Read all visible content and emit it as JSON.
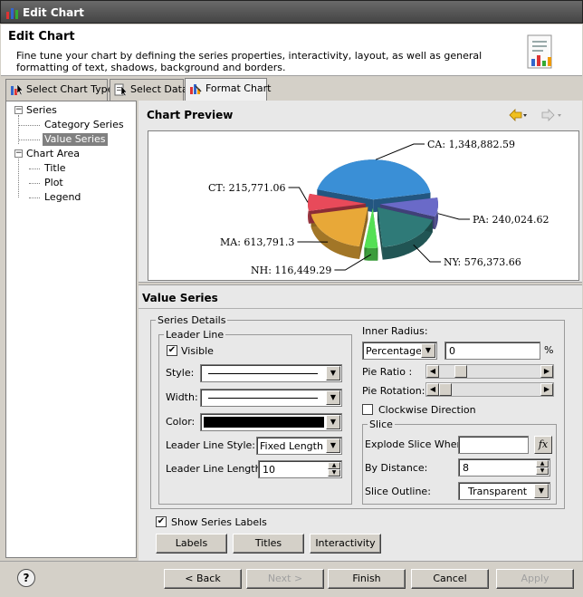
{
  "window": {
    "title": "Edit Chart"
  },
  "header": {
    "title": "Edit Chart",
    "description": "Fine tune your chart by defining the series properties, interactivity, layout, as well as general formatting of text, shadows, background and borders."
  },
  "tabs": [
    {
      "label": "Select Chart Type"
    },
    {
      "label": "Select Data"
    },
    {
      "label": "Format Chart"
    }
  ],
  "tree": {
    "series": "Series",
    "category_series": "Category Series",
    "value_series": "Value Series",
    "chart_area": "Chart Area",
    "title": "Title",
    "plot": "Plot",
    "legend": "Legend"
  },
  "preview": {
    "title": "Chart Preview",
    "labels": {
      "ca": "CA: 1,348,882.59",
      "pa": "PA: 240,024.62",
      "ny": "NY: 576,373.66",
      "nh": "NH: 116,449.29",
      "ma": "MA: 613,791.3",
      "ct": "CT: 215,771.06"
    }
  },
  "chart_data": {
    "type": "pie",
    "categories": [
      "CA",
      "PA",
      "NY",
      "NH",
      "MA",
      "CT"
    ],
    "values": [
      1348882.59,
      240024.62,
      576373.66,
      116449.29,
      613791.3,
      215771.06
    ],
    "colors": [
      "#3a8fd6",
      "#6a6ac8",
      "#2f7a78",
      "#55e055",
      "#e8a838",
      "#e84a5a"
    ],
    "title": "",
    "legend": "none"
  },
  "value_series": {
    "title": "Value Series",
    "series_details": "Series Details",
    "leader_line": {
      "legend": "Leader Line",
      "visible_label": "Visible",
      "visible": true,
      "style_label": "Style:",
      "width_label": "Width:",
      "color_label": "Color:",
      "color": "#000000",
      "leader_style_label": "Leader Line Style:",
      "leader_style_value": "Fixed Length",
      "leader_length_label": "Leader Line Length:",
      "leader_length_value": "10"
    },
    "inner_radius_label": "Inner Radius:",
    "inner_radius_unit": "Percentage",
    "inner_radius_value": "0",
    "inner_radius_suffix": "%",
    "pie_ratio_label": "Pie Ratio :",
    "pie_ratio_level": 0.17,
    "pie_rotation_label": "Pie Rotation:",
    "pie_rotation_level": 0.0,
    "clockwise_label": "Clockwise Direction",
    "clockwise": false,
    "slice": {
      "legend": "Slice",
      "explode_label": "Explode Slice When:",
      "explode_value": "",
      "fx_label": "fx",
      "distance_label": "By Distance:",
      "distance_value": "8",
      "outline_label": "Slice Outline:",
      "outline_value": "Transparent"
    },
    "show_labels_label": "Show Series Labels",
    "show_labels": true,
    "buttons": {
      "labels": "Labels",
      "titles": "Titles",
      "interactivity": "Interactivity"
    }
  },
  "footer": {
    "help": "?",
    "back": "< Back",
    "next": "Next >",
    "finish": "Finish",
    "cancel": "Cancel",
    "apply": "Apply"
  }
}
